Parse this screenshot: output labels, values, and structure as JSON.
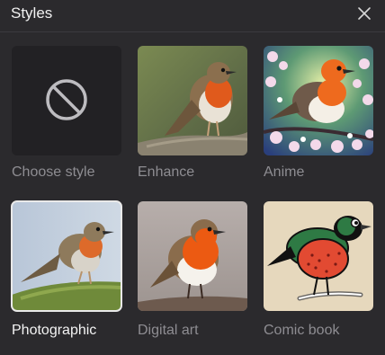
{
  "panel": {
    "title": "Styles"
  },
  "icons": {
    "close": "close-icon",
    "none": "prohibited-icon"
  },
  "styles": [
    {
      "label": "Choose style",
      "selected": false
    },
    {
      "label": "Enhance",
      "selected": false
    },
    {
      "label": "Anime",
      "selected": false
    },
    {
      "label": "Photographic",
      "selected": true
    },
    {
      "label": "Digital art",
      "selected": false
    },
    {
      "label": "Comic book",
      "selected": false
    }
  ]
}
